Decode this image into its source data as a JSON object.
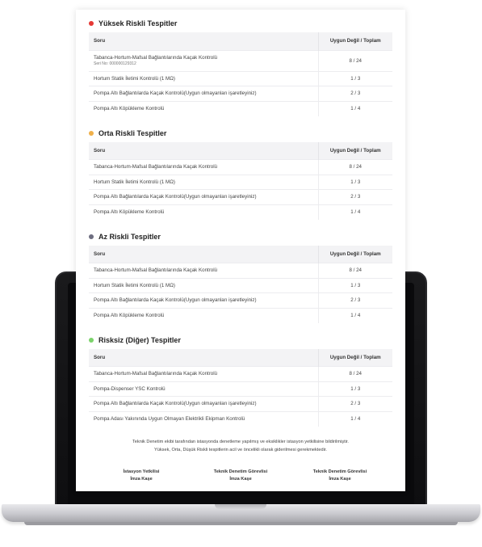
{
  "sections": [
    {
      "title": "Yüksek Riskli Tespitler",
      "dot_color": "#e53935",
      "header": {
        "question": "Soru",
        "ratio": "Uygun Değil / Toplam"
      },
      "rows": [
        {
          "question": "Tabanca-Hortum-Mafsal Bağlantılarında Kaçak Kontrolü",
          "sub": "Seri No: 000000129312",
          "ratio": "8 / 24"
        },
        {
          "question": "Hortum Statik İletimi Kontrolü (1 MΩ)",
          "ratio": "1 / 3"
        },
        {
          "question": "Pompa Altı Bağlantılarda Kaçak Kontrolü(Uygun olmayanları işaretleyiniz)",
          "ratio": "2 / 3"
        },
        {
          "question": "Pompa Altı Köpükleme Kontrolü",
          "ratio": "1 / 4"
        }
      ]
    },
    {
      "title": "Orta Riskli Tespitler",
      "dot_color": "#f0b04a",
      "header": {
        "question": "Soru",
        "ratio": "Uygun Değil / Toplam"
      },
      "rows": [
        {
          "question": "Tabanca-Hortum-Mafsal Bağlantılarında Kaçak Kontrolü",
          "ratio": "8 / 24"
        },
        {
          "question": "Hortum Statik İletimi Kontrolü (1 MΩ)",
          "ratio": "1 / 3"
        },
        {
          "question": "Pompa Altı Bağlantılarda Kaçak Kontrolü(Uygun olmayanları işaretleyiniz)",
          "ratio": "2 / 3"
        },
        {
          "question": "Pompa Altı Köpükleme Kontrolü",
          "ratio": "1 / 4"
        }
      ]
    },
    {
      "title": "Az Riskli Tespitler",
      "dot_color": "#6e6e80",
      "header": {
        "question": "Soru",
        "ratio": "Uygun Değil / Toplam"
      },
      "rows": [
        {
          "question": "Tabanca-Hortum-Mafsal Bağlantılarında Kaçak Kontrolü",
          "ratio": "8 / 24"
        },
        {
          "question": "Hortum Statik İletimi Kontrolü (1 MΩ)",
          "ratio": "1 / 3"
        },
        {
          "question": "Pompa Altı Bağlantılarda Kaçak Kontrolü(Uygun olmayanları işaretleyiniz)",
          "ratio": "2 / 3"
        },
        {
          "question": "Pompa Altı Köpükleme Kontrolü",
          "ratio": "1 / 4"
        }
      ]
    },
    {
      "title": "Risksiz (Diğer) Tespitler",
      "dot_color": "#7bd36b",
      "header": {
        "question": "Soru",
        "ratio": "Uygun Değil / Toplam"
      },
      "rows": [
        {
          "question": "Tabanca-Hortum-Mafsal Bağlantılarında Kaçak Kontrolü",
          "ratio": "8 / 24"
        },
        {
          "question": "Pompa-Dispenser YSC Kontrolü",
          "ratio": "1 / 3"
        },
        {
          "question": "Pompa Altı Bağlantılarda Kaçak Kontrolü(Uygun olmayanları işaretleyiniz)",
          "ratio": "2 / 3"
        },
        {
          "question": "Pompa Adası Yakınında Uygun Olmayan Elektrikli Ekipman Kontrolü",
          "ratio": "1 / 4"
        }
      ]
    }
  ],
  "footer": {
    "note_line1": "Teknik Denetim ekibi tarafından istasyonda denetleme yapılmış ve eksiklikler istasyon yetkilisine bildirilmiştir.",
    "note_line2": "Yüksek, Orta, Düşük Riskli tespitlerin acil ve öncelikli olarak giderilmesi gerekmektedir."
  },
  "signatures": [
    {
      "role": "İstasyon Yetkilisi",
      "label": "İmza Kaşe"
    },
    {
      "role": "Teknik Denetim Görevlisi",
      "label": "İmza Kaşe"
    },
    {
      "role": "Teknik Denetim Görevlisi",
      "label": "İmza Kaşe"
    }
  ]
}
